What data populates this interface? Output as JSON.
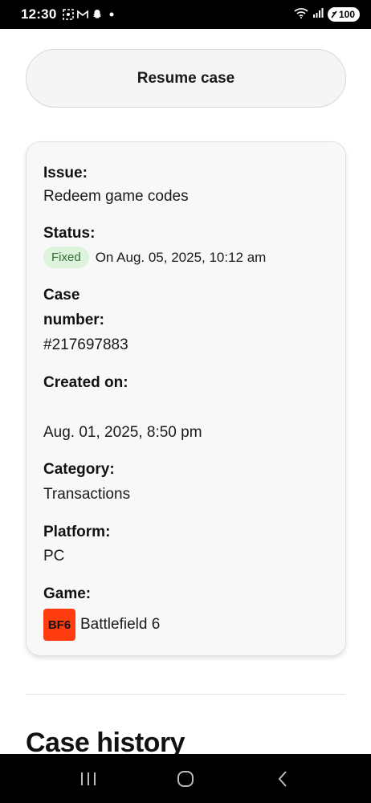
{
  "status_bar": {
    "time": "12:30",
    "battery": "100"
  },
  "resume_button": {
    "label": "Resume case"
  },
  "case": {
    "issue_label": "Issue:",
    "issue_value": "Redeem game codes",
    "status_label": "Status:",
    "status_badge": "Fixed",
    "status_date": "On Aug. 05, 2025, 10:12 am",
    "case_number_label": "Case number:",
    "case_number_value": "#217697883",
    "created_label": "Created on:",
    "created_value": "Aug. 01, 2025, 8:50 pm",
    "category_label": "Category:",
    "category_value": "Transactions",
    "platform_label": "Platform:",
    "platform_value": "PC",
    "game_label": "Game:",
    "game_logo_text": "BF6",
    "game_value": "Battlefield 6"
  },
  "history": {
    "title": "Case history"
  },
  "colors": {
    "badge_bg": "#ddf3dc",
    "badge_text": "#2f6d31",
    "game_logo_bg": "#ff3b10"
  }
}
